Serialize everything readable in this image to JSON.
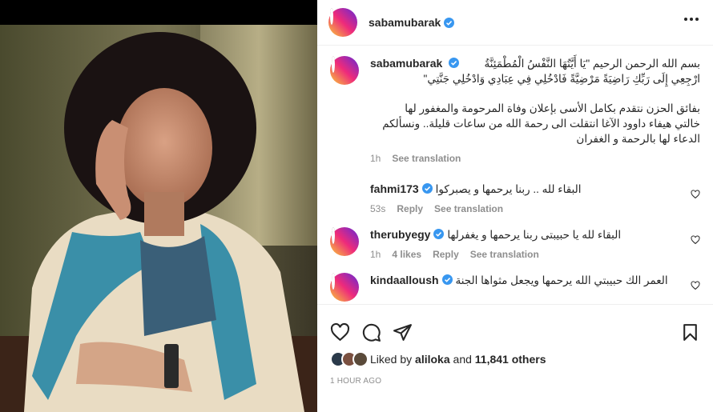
{
  "post": {
    "username": "sabamubarak",
    "caption_username": "sabamubarak",
    "caption_line1": "بسم الله الرحمن الرحيم \"يَا أَيَّتُهَا النَّفْسُ الْمُطْمَئِنَّةُ",
    "caption_line2": "ارْجِعِي إِلَى رَبِّكِ رَاضِيَةً مَرْضِيَّةً فَادْخُلِي فِي عِبَادِي وَادْخُلِي جَنَّتِي\"",
    "caption_line3": "بفائق الحزن نتقدم بكامل الأسى بإعلان وفاة المرحومة والمغفور لها",
    "caption_line4": "خالتي هيفاء داوود الآغا انتقلت الى رحمة الله من ساعات قليلة.. ونسألكم",
    "caption_line5": "الدعاء لها بالرحمة و الغفران",
    "caption_time": "1h",
    "caption_see_translation": "See translation"
  },
  "comments": [
    {
      "username": "fahmi173",
      "text": "البقاء لله .. ربنا يرحمها و يصبركوا",
      "time": "53s",
      "reply": "Reply",
      "translate": "See translation",
      "likes": ""
    },
    {
      "username": "therubyegy",
      "text": "البقاء لله يا حبيبتى ربنا يرحمها و يغفرلها",
      "time": "1h",
      "likes": "4 likes",
      "reply": "Reply",
      "translate": "See translation"
    },
    {
      "username": "kindaalloush",
      "text": "العمر الك حبيبتي الله يرحمها ويجعل مثواها الجنة",
      "time": "",
      "likes": "",
      "reply": "",
      "translate": ""
    }
  ],
  "likes": {
    "prefix": "Liked by",
    "user": "aliloka",
    "and": "and",
    "count": "11,841 others"
  },
  "timestamp": "1 HOUR AGO",
  "colors": {
    "verified": "#3897f0",
    "secondary_text": "#8e8e8e",
    "primary_text": "#262626"
  }
}
